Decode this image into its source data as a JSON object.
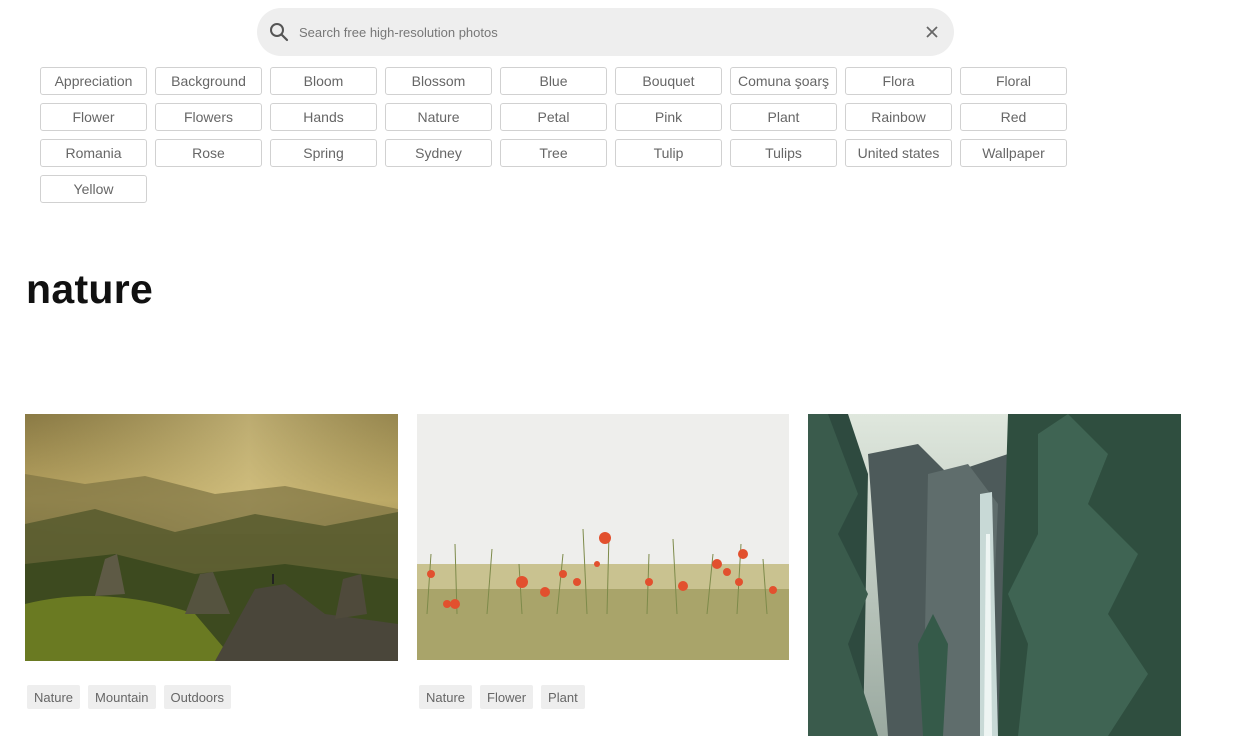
{
  "search": {
    "placeholder": "Search free high-resolution photos",
    "value": ""
  },
  "tags": [
    "Appreciation",
    "Background",
    "Bloom",
    "Blossom",
    "Blue",
    "Bouquet",
    "Comuna şoarş",
    "Flora",
    "Floral",
    "Flower",
    "Flowers",
    "Hands",
    "Nature",
    "Petal",
    "Pink",
    "Plant",
    "Rainbow",
    "Red",
    "Romania",
    "Rose",
    "Spring",
    "Sydney",
    "Tree",
    "Tulip",
    "Tulips",
    "United states",
    "Wallpaper",
    "Yellow"
  ],
  "page_title": "nature",
  "photos": [
    {
      "tags": [
        "Nature",
        "Mountain",
        "Outdoors"
      ]
    },
    {
      "tags": [
        "Nature",
        "Flower",
        "Plant"
      ]
    },
    {
      "tags": []
    }
  ]
}
